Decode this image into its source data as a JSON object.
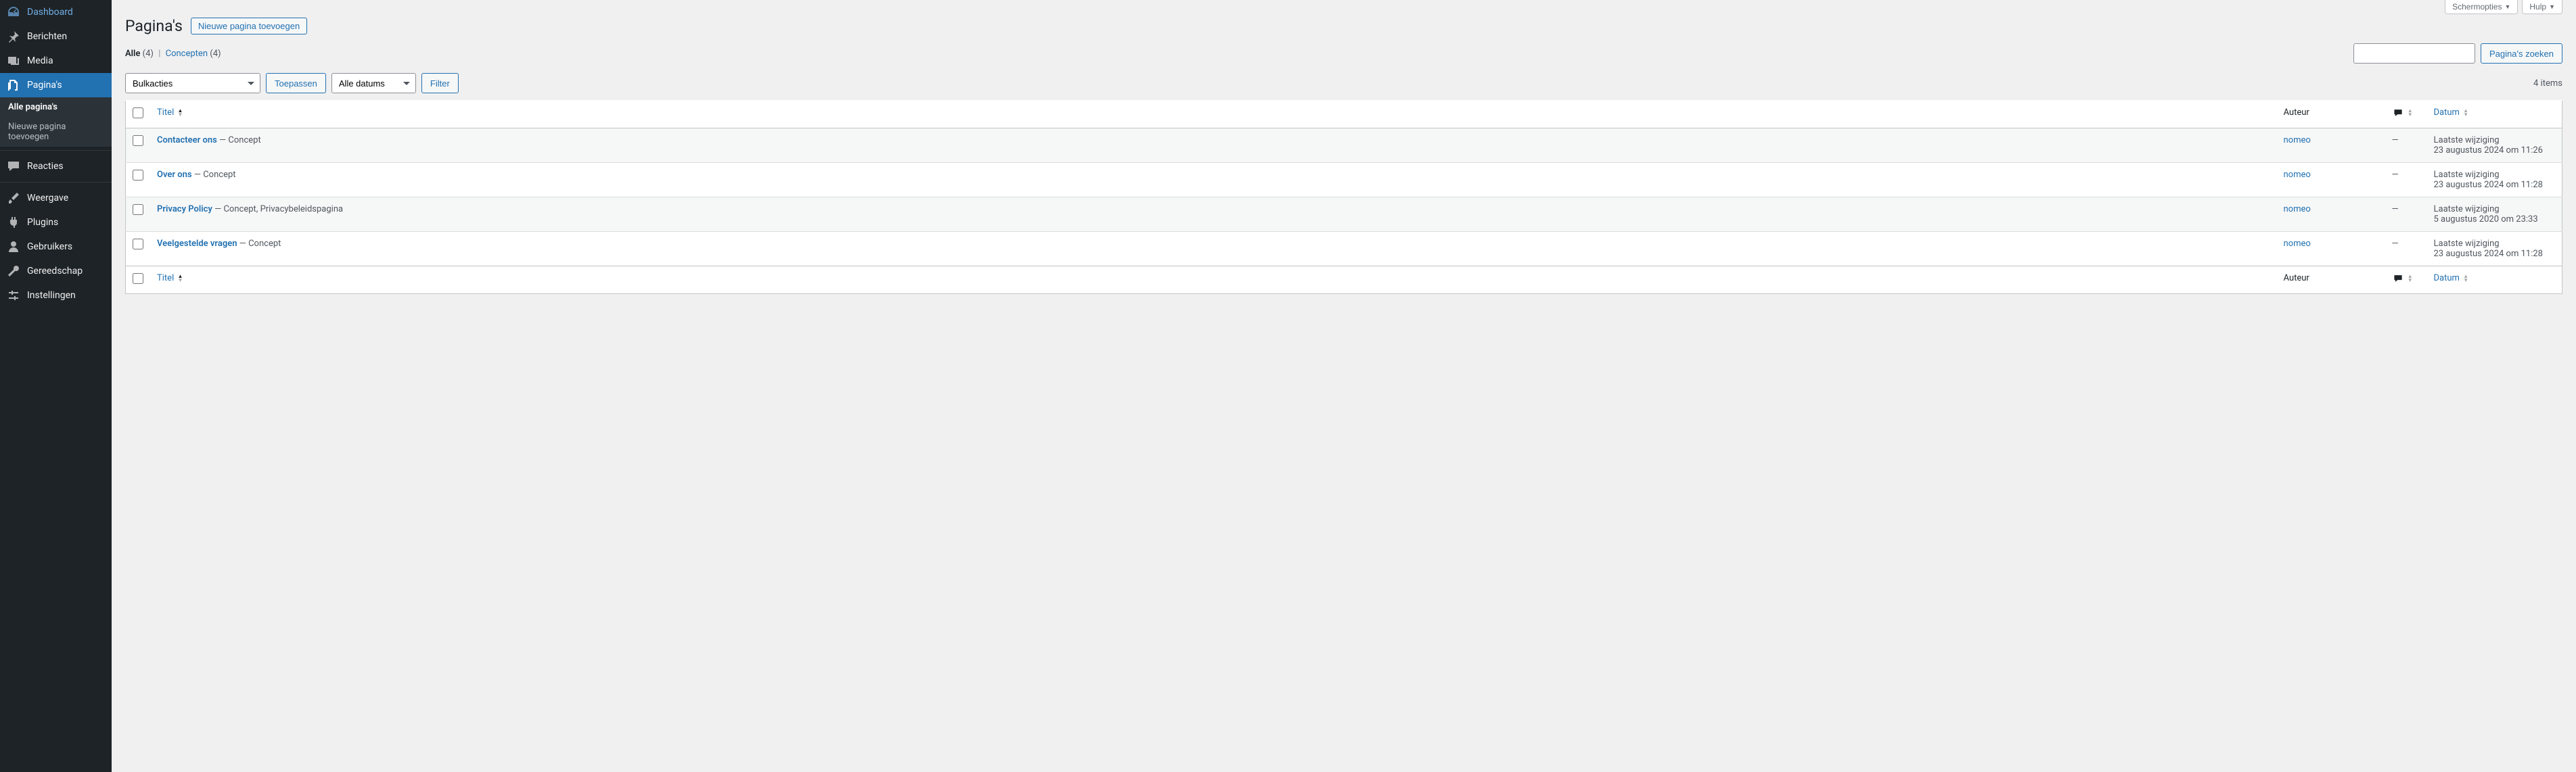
{
  "screen_meta": {
    "options_label": "Schermopties",
    "help_label": "Hulp"
  },
  "sidebar": {
    "items": [
      {
        "id": "dashboard",
        "label": "Dashboard",
        "icon": "dashboard"
      },
      {
        "id": "posts",
        "label": "Berichten",
        "icon": "pin"
      },
      {
        "id": "media",
        "label": "Media",
        "icon": "media"
      },
      {
        "id": "pages",
        "label": "Pagina's",
        "icon": "page",
        "current": true,
        "sub": [
          {
            "id": "all",
            "label": "Alle pagina's",
            "current": true
          },
          {
            "id": "new",
            "label": "Nieuwe pagina toevoegen"
          }
        ]
      },
      {
        "id": "comments",
        "label": "Reacties",
        "icon": "comment",
        "sep_before": true
      },
      {
        "id": "appearance",
        "label": "Weergave",
        "icon": "brush",
        "sep_before": true
      },
      {
        "id": "plugins",
        "label": "Plugins",
        "icon": "plug"
      },
      {
        "id": "users",
        "label": "Gebruikers",
        "icon": "user"
      },
      {
        "id": "tools",
        "label": "Gereedschap",
        "icon": "wrench"
      },
      {
        "id": "settings",
        "label": "Instellingen",
        "icon": "sliders"
      }
    ]
  },
  "heading": {
    "title": "Pagina's",
    "add_new": "Nieuwe pagina toevoegen"
  },
  "subsub": {
    "all_label": "Alle",
    "all_count": "(4)",
    "sep": "|",
    "drafts_label": "Concepten",
    "drafts_count": "(4)"
  },
  "search": {
    "button": "Pagina's zoeken"
  },
  "tablenav": {
    "bulk_label": "Bulkacties",
    "apply": "Toepassen",
    "dates_label": "Alle datums",
    "filter": "Filter",
    "count": "4 items"
  },
  "columns": {
    "title": "Titel",
    "author": "Auteur",
    "date": "Datum"
  },
  "rows": [
    {
      "title": "Contacteer ons",
      "state": " — Concept",
      "author": "nomeo",
      "comments": "—",
      "date_top": "Laatste wijziging",
      "date_bottom": "23 augustus 2024 om 11:26",
      "alt": true
    },
    {
      "title": "Over ons",
      "state": " — Concept",
      "author": "nomeo",
      "comments": "—",
      "date_top": "Laatste wijziging",
      "date_bottom": "23 augustus 2024 om 11:28",
      "alt": false
    },
    {
      "title": "Privacy Policy",
      "state": " — Concept, Privacybeleidspagina",
      "author": "nomeo",
      "comments": "—",
      "date_top": "Laatste wijziging",
      "date_bottom": "5 augustus 2020 om 23:33",
      "alt": true
    },
    {
      "title": "Veelgestelde vragen",
      "state": " — Concept",
      "author": "nomeo",
      "comments": "—",
      "date_top": "Laatste wijziging",
      "date_bottom": "23 augustus 2024 om 11:28",
      "alt": false
    }
  ]
}
